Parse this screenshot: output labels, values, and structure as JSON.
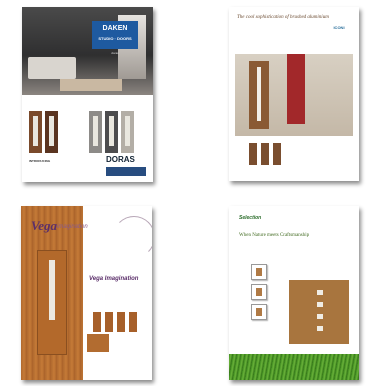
{
  "pages": [
    {
      "id": "p1",
      "brand_logo": "DAKEN",
      "brand_sub": "STUDIO · DOORS",
      "logo_tagline": "doras",
      "intro_text": "INTRODUCING",
      "doras_logo": "DORAS",
      "accent": "#1e5aa0"
    },
    {
      "id": "p2",
      "title": "The cool sophistication of brushed aluminium",
      "logo": "ICONI",
      "accent": "#a2282a"
    },
    {
      "id": "p3",
      "brand": "Vega",
      "brand_suffix": "imagination",
      "headline": "Vega Imagination",
      "accent": "#5b2f6a"
    },
    {
      "id": "p4",
      "header": "Selection",
      "subtitle": "When Nature meets Craftsmanship",
      "accent": "#3e8a1f"
    }
  ]
}
